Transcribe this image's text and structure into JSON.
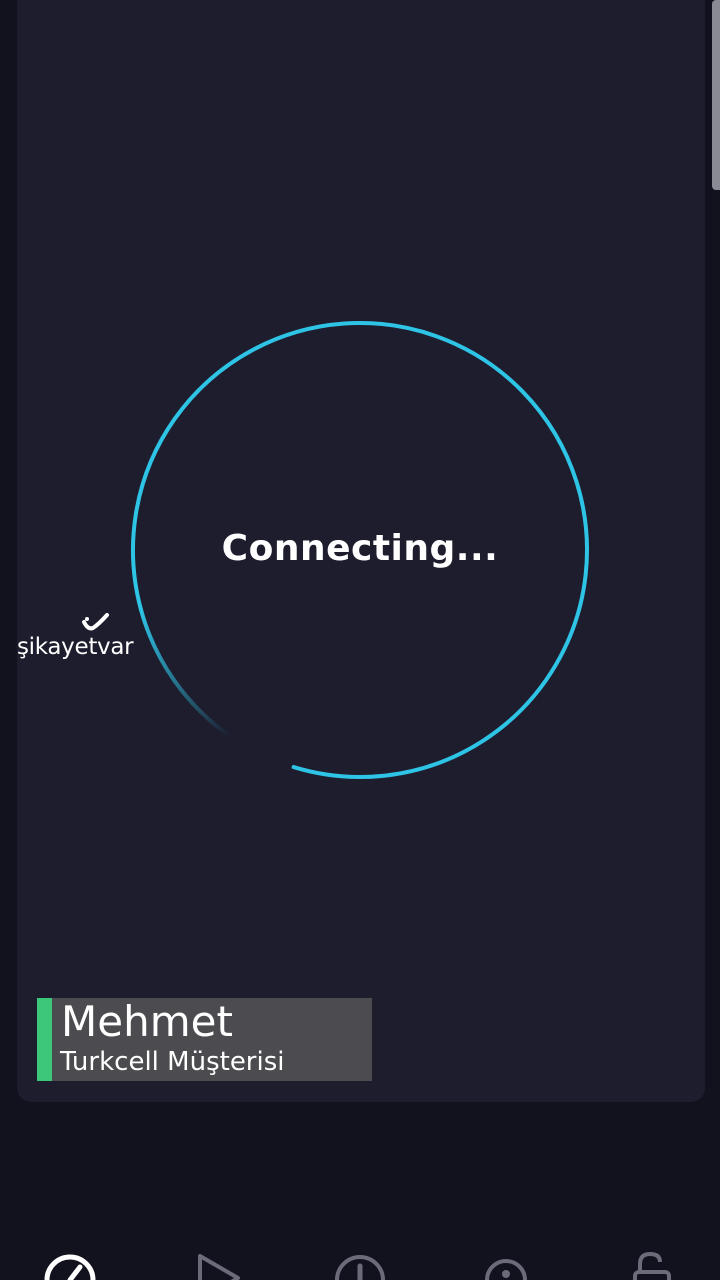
{
  "status": {
    "text": "Connecting..."
  },
  "watermark": {
    "text": "şikayetvar"
  },
  "caption": {
    "name": "Mehmet",
    "subtitle": "Turkcell Müşterisi"
  },
  "nav": {
    "items": [
      {
        "icon": "speedometer-icon",
        "active": true
      },
      {
        "icon": "play-icon",
        "active": false
      },
      {
        "icon": "alert-icon",
        "active": false
      },
      {
        "icon": "location-icon",
        "active": false
      },
      {
        "icon": "unlock-icon",
        "active": false
      }
    ]
  },
  "colors": {
    "background": "#12121f",
    "panel": "#1e1d2e",
    "ring": "#2ec4e6",
    "caption_accent": "#3cc77a",
    "caption_bg": "#505054"
  }
}
